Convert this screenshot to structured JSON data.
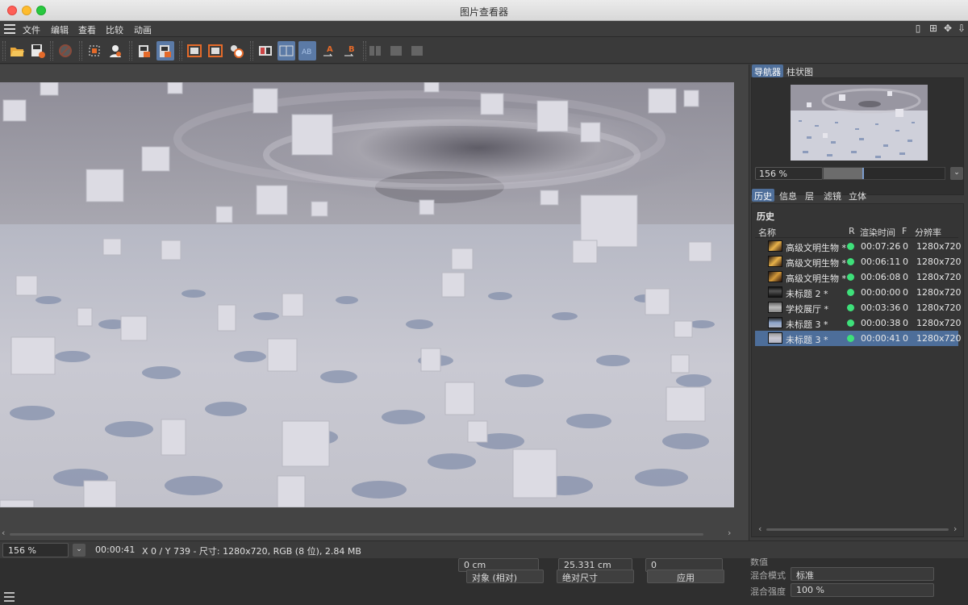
{
  "window": {
    "title": "图片查看器"
  },
  "menu": {
    "items": [
      "文件",
      "编辑",
      "查看",
      "比较",
      "动画"
    ]
  },
  "navigator": {
    "tabs": [
      "导航器",
      "柱状图"
    ],
    "zoom": "156 %"
  },
  "history": {
    "tabs": [
      "历史",
      "信息",
      "层",
      "滤镜",
      "立体"
    ],
    "heading": "历史",
    "columns": {
      "name": "名称",
      "r": "R",
      "time": "渲染时间",
      "f": "F",
      "res": "分辨率"
    },
    "rows": [
      {
        "name": "高级文明生物 *",
        "time": "00:07:26",
        "f": "0",
        "res": "1280x720"
      },
      {
        "name": "高级文明生物 *",
        "time": "00:06:11",
        "f": "0",
        "res": "1280x720"
      },
      {
        "name": "高级文明生物 *",
        "time": "00:06:08",
        "f": "0",
        "res": "1280x720"
      },
      {
        "name": "未标题 2 *",
        "time": "00:00:00",
        "f": "0",
        "res": "1280x720"
      },
      {
        "name": "学校展厅 *",
        "time": "00:03:36",
        "f": "0",
        "res": "1280x720"
      },
      {
        "name": "未标题 3 *",
        "time": "00:00:38",
        "f": "0",
        "res": "1280x720"
      },
      {
        "name": "未标题 3 *",
        "time": "00:00:41",
        "f": "0",
        "res": "1280x720"
      }
    ]
  },
  "status": {
    "zoom": "156 %",
    "time": "00:00:41",
    "info": "X 0 / Y 739 - 尺寸: 1280x720, RGB (8 位), 2.84 MB"
  },
  "underlay": {
    "field1": "0 cm",
    "field2": "25.331 cm",
    "field3": "0",
    "dropdown1": "对象 (相对)",
    "dropdown2": "绝对尺寸",
    "apply": "应用",
    "blend_mode_label": "混合模式",
    "blend_mode_value": "标准",
    "blend_strength_label": "混合强度",
    "blend_strength_value": "100 %",
    "data_label": "数值"
  },
  "colors": {
    "accent": "#4d6e9a",
    "status_green": "#3ee07a"
  }
}
